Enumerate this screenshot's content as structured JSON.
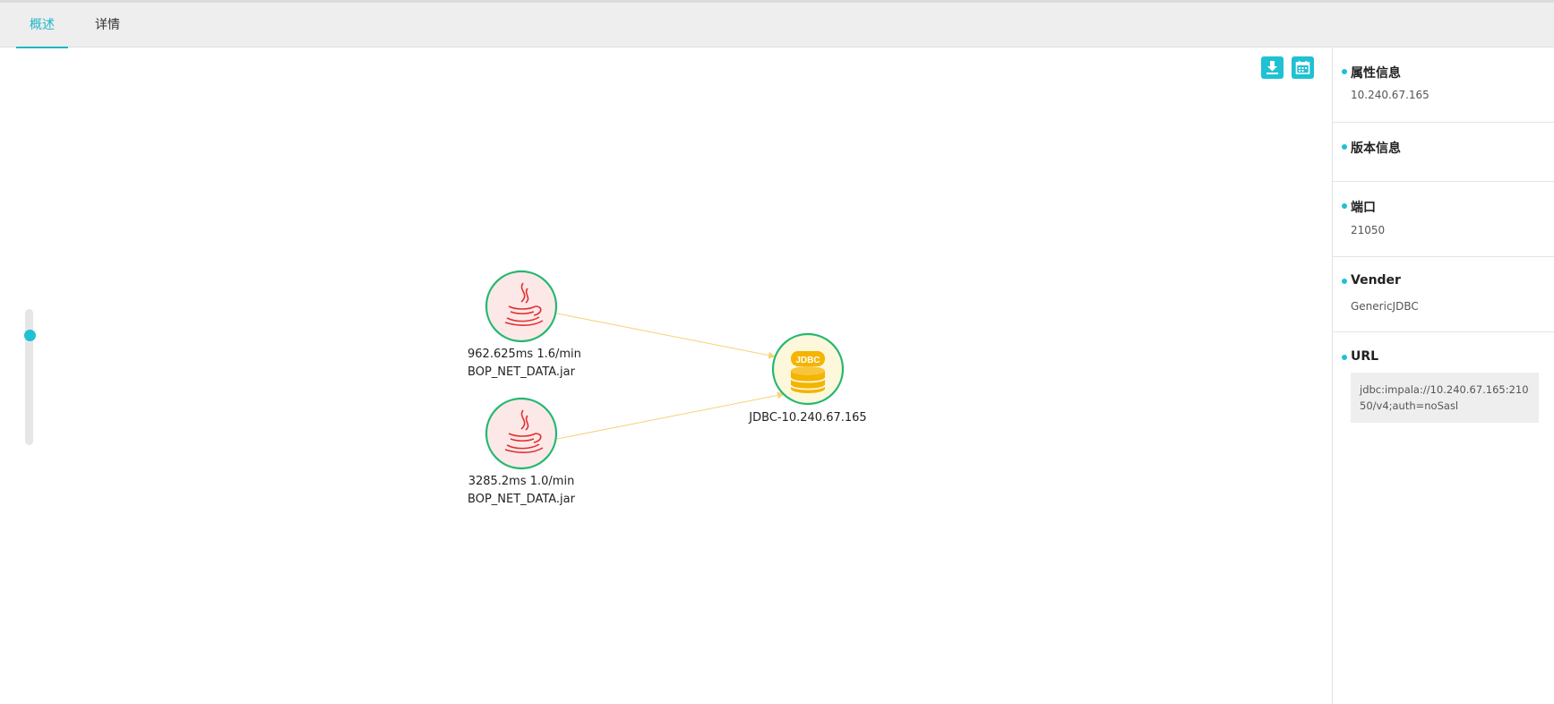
{
  "tabs": [
    {
      "label": "概述",
      "active": true
    },
    {
      "label": "详情",
      "active": false
    }
  ],
  "toolbar": {
    "download_icon": "download-icon",
    "calendar_icon": "calendar-icon",
    "accent_color": "#1fc1d3"
  },
  "zoom": {
    "level": 0.83
  },
  "graph": {
    "nodes": [
      {
        "id": "java1",
        "type": "java",
        "metric": "962.625ms 1.6/min",
        "name": "BOP_NET_DATA.jar"
      },
      {
        "id": "java2",
        "type": "java",
        "metric": "3285.2ms 1.0/min",
        "name": "BOP_NET_DATA.jar"
      },
      {
        "id": "jdbc",
        "type": "database",
        "badge": "JDBC",
        "name": "JDBC-10.240.67.165"
      }
    ],
    "edges": [
      {
        "from": "java1",
        "to": "jdbc"
      },
      {
        "from": "java2",
        "to": "jdbc"
      }
    ],
    "colors": {
      "node_border": "#23b86f",
      "java_fill": "#fde8e8",
      "db_fill": "#fdf7dc",
      "edge": "#f6d27a",
      "db_icon": "#f4b400",
      "java_icon": "#e0302f"
    }
  },
  "sidebar": {
    "attributes": {
      "title": "属性信息",
      "value": "10.240.67.165"
    },
    "version": {
      "title": "版本信息",
      "value": ""
    },
    "port": {
      "title": "端口",
      "value": "21050"
    },
    "vender": {
      "title": "Vender",
      "value": "GenericJDBC"
    },
    "url": {
      "title": "URL",
      "value": "jdbc:impala://10.240.67.165:21050/v4;auth=noSasl"
    }
  }
}
